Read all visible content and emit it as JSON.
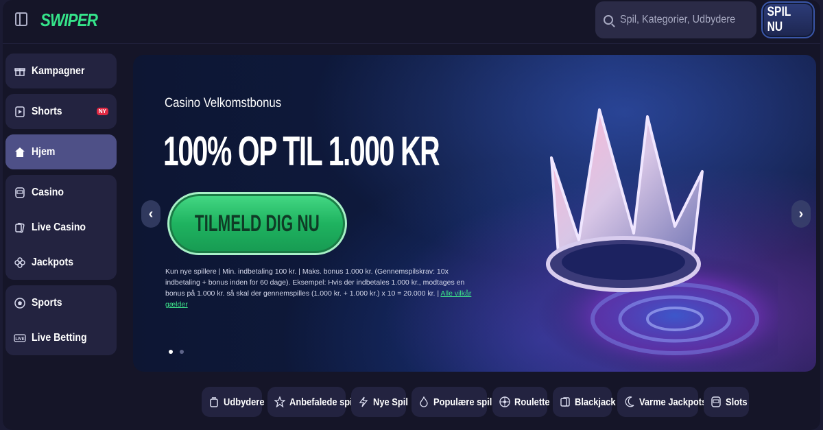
{
  "header": {
    "logo": "SWIPER",
    "search_placeholder": "Spil, Kategorier, Udbydere",
    "cta_label": "SPIL NU"
  },
  "sidebar": {
    "groups": [
      {
        "items": [
          {
            "label": "Kampagner",
            "icon": "gift-icon"
          }
        ]
      },
      {
        "items": [
          {
            "label": "Shorts",
            "icon": "play-icon",
            "badge": "NY"
          }
        ]
      },
      {
        "items": [
          {
            "label": "Hjem",
            "icon": "home-icon",
            "active": true
          }
        ]
      },
      {
        "items": [
          {
            "label": "Casino",
            "icon": "slot-machine-icon"
          },
          {
            "label": "Live Casino",
            "icon": "cards-icon"
          },
          {
            "label": "Jackpots",
            "icon": "clover-icon"
          }
        ]
      },
      {
        "items": [
          {
            "label": "Sports",
            "icon": "football-icon"
          },
          {
            "label": "Live Betting",
            "icon": "live-icon"
          }
        ]
      }
    ]
  },
  "hero": {
    "subtitle": "Casino Velkomstbonus",
    "title": "100% OP TIL 1.000 KR",
    "cta": "TILMELD DIG NU",
    "terms": "Kun nye spillere | Min. indbetaling 100 kr. | Maks. bonus 1.000 kr. (Gennemspilskrav: 10x indbetaling + bonus inden for 60 dage). Eksempel: Hvis der indbetales 1.000 kr., modtages en bonus på 1.000 kr. så skal der gennemspilles (1.000 kr. + 1.000 kr.) x 10 = 20.000 kr. |",
    "terms_link": "Alle vilkår gælder",
    "slide_count": 2,
    "active_slide": 1
  },
  "categories": [
    {
      "label": "Udbydere",
      "icon": "providers-icon"
    },
    {
      "label": "Anbefalede spil",
      "icon": "star-icon"
    },
    {
      "label": "Nye Spil",
      "icon": "lightning-icon"
    },
    {
      "label": "Populære spil",
      "icon": "flame-icon"
    },
    {
      "label": "Roulette",
      "icon": "roulette-icon"
    },
    {
      "label": "Blackjack",
      "icon": "cards-icon"
    },
    {
      "label": "Varme Jackpots",
      "icon": "moon-icon"
    },
    {
      "label": "Slots",
      "icon": "slot-machine-icon"
    }
  ],
  "colors": {
    "brand_green": "#35e48a",
    "active_nav": "#4e5087",
    "badge_red": "#e02a44"
  }
}
